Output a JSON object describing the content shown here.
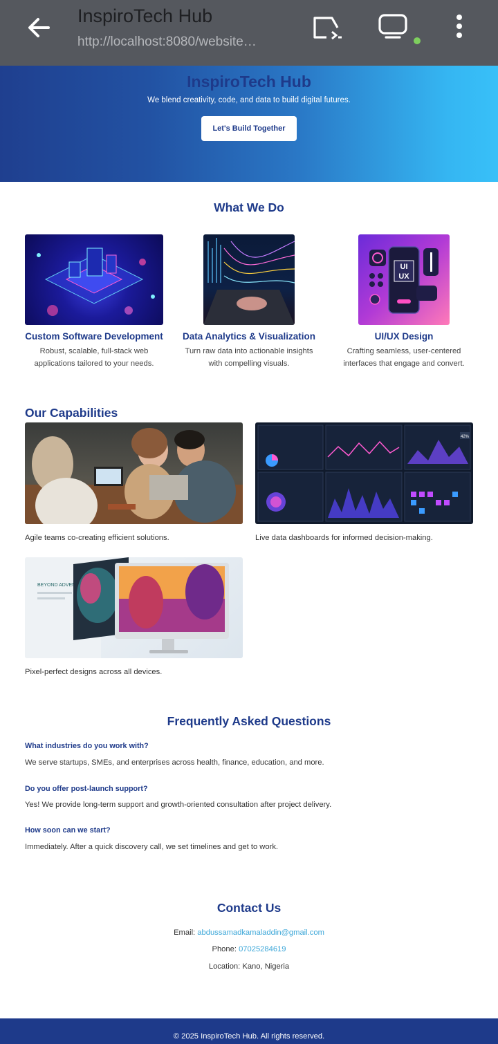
{
  "browser": {
    "title": "InspiroTech Hub",
    "url": "http://localhost:8080/website…",
    "icons": [
      "back-arrow-icon",
      "cast-icon",
      "monitor-icon",
      "more-vert-icon"
    ],
    "status_dot_color": "#7ecf5e"
  },
  "hero": {
    "title": "InspiroTech Hub",
    "tagline": "We blend creativity, code, and data to build digital futures.",
    "cta_label": "Let's Build Together"
  },
  "services": {
    "heading": "What We Do",
    "items": [
      {
        "name": "Custom Software Development",
        "desc_line1": "Robust, scalable, full-stack web",
        "desc_line2": "applications tailored to your needs."
      },
      {
        "name": "Data Analytics & Visualization",
        "desc_line1": "Turn raw data into actionable insights",
        "desc_line2": "with compelling visuals."
      },
      {
        "name": "UI/UX Design",
        "desc_line1": "Crafting seamless, user-centered",
        "desc_line2": "interfaces that engage and convert.",
        "image_text_1": "UI",
        "image_text_2": "UX"
      }
    ]
  },
  "capabilities": {
    "heading": "Our Capabilities",
    "items": [
      {
        "caption": "Agile teams co-creating efficient solutions."
      },
      {
        "caption": "Live data dashboards for informed decision-making.",
        "image_badge": "42%"
      },
      {
        "caption": "Pixel-perfect designs across all devices.",
        "image_text": "BEYOND ADVENTURES"
      }
    ]
  },
  "faq": {
    "heading": "Frequently Asked Questions",
    "items": [
      {
        "q": "What industries do you work with?",
        "a": "We serve startups, SMEs, and enterprises across health, finance, education, and more."
      },
      {
        "q": "Do you offer post-launch support?",
        "a": "Yes! We provide long-term support and growth-oriented consultation after project delivery."
      },
      {
        "q": "How soon can we start?",
        "a": "Immediately. After a quick discovery call, we set timelines and get to work."
      }
    ]
  },
  "contact": {
    "heading": "Contact Us",
    "email_label": "Email: ",
    "email": "abdussamadkamaladdin@gmail.com",
    "phone_label": "Phone: ",
    "phone": "07025284619",
    "location": "Location: Kano, Nigeria"
  },
  "footer": {
    "text": "© 2025 InspiroTech Hub. All rights reserved."
  },
  "colors": {
    "brand_blue": "#1e3a8a",
    "link": "#3aa6d8",
    "topbar": "#55585e"
  }
}
